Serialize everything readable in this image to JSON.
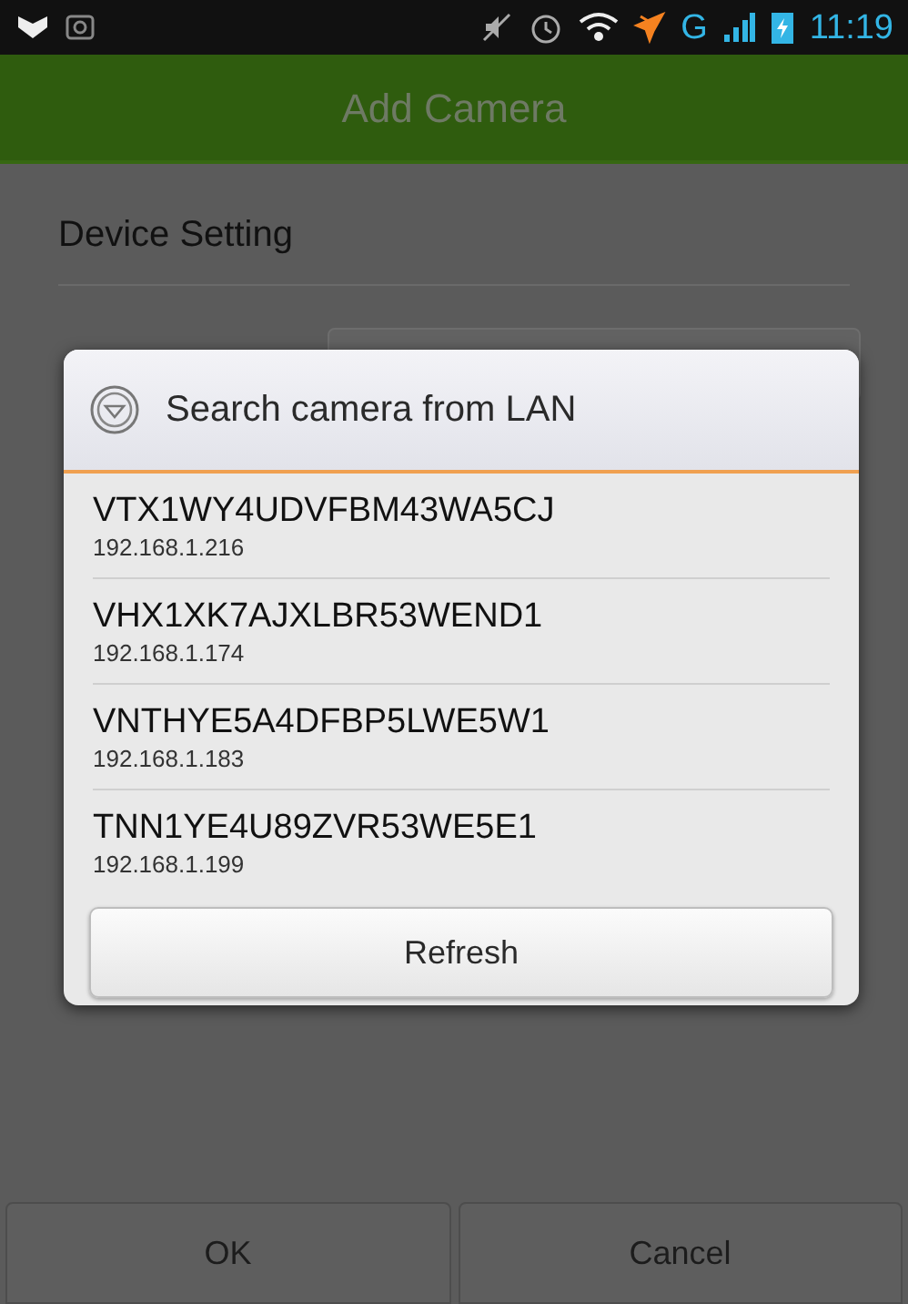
{
  "status_bar": {
    "network": "G",
    "time": "11:19"
  },
  "title_bar": {
    "title": "Add Camera"
  },
  "form": {
    "heading": "Device Setting"
  },
  "dialog": {
    "title": "Search camera from LAN",
    "cameras": [
      {
        "id": "VTX1WY4UDVFBM43WA5CJ",
        "ip": "192.168.1.216"
      },
      {
        "id": "VHX1XK7AJXLBR53WEND1",
        "ip": "192.168.1.174"
      },
      {
        "id": "VNTHYE5A4DFBP5LWE5W1",
        "ip": "192.168.1.183"
      },
      {
        "id": "TNN1YE4U89ZVR53WE5E1",
        "ip": "192.168.1.199"
      }
    ],
    "refresh_button": "Refresh"
  },
  "buttons": [
    "OK",
    "Cancel"
  ]
}
